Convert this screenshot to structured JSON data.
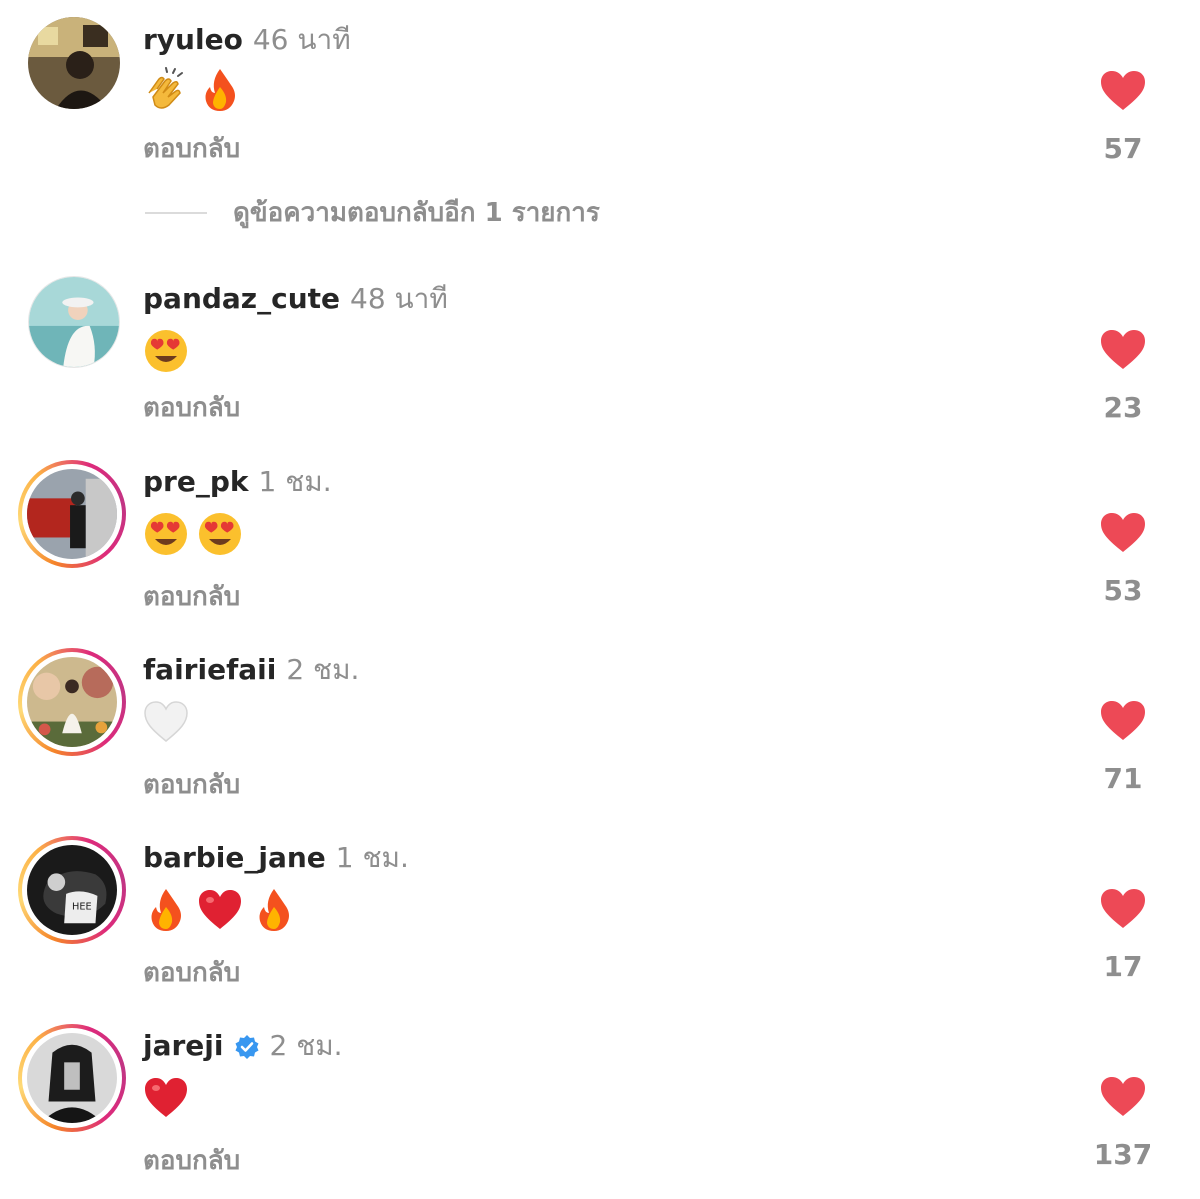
{
  "reply_label": "ตอบกลับ",
  "view_more_replies": "ดูข้อความตอบกลับอีก 1 รายการ",
  "colors": {
    "like": "#ed4956",
    "muted": "#8e8e8e",
    "text": "#262626",
    "verified": "#3897f0"
  },
  "comments": [
    {
      "username": "ryuleo",
      "time": "46 นาที",
      "emojis": [
        "clapping-hands",
        "fire"
      ],
      "likes": "57",
      "verified": false
    },
    {
      "username": "pandaz_cute",
      "time": "48 นาที",
      "emojis": [
        "heart-eyes"
      ],
      "likes": "23",
      "verified": false
    },
    {
      "username": "pre_pk",
      "time": "1 ชม.",
      "emojis": [
        "heart-eyes",
        "heart-eyes"
      ],
      "likes": "53",
      "verified": false,
      "story_ring": true
    },
    {
      "username": "fairiefaii",
      "time": "2 ชม.",
      "emojis": [
        "white-heart"
      ],
      "likes": "71",
      "verified": false,
      "story_ring": true
    },
    {
      "username": "barbie_jane",
      "time": "1 ชม.",
      "emojis": [
        "fire",
        "red-heart",
        "fire"
      ],
      "likes": "17",
      "verified": false,
      "story_ring": true
    },
    {
      "username": "jareji",
      "time": "2 ชม.",
      "emojis": [
        "red-heart"
      ],
      "likes": "137",
      "verified": true,
      "story_ring": true
    }
  ]
}
